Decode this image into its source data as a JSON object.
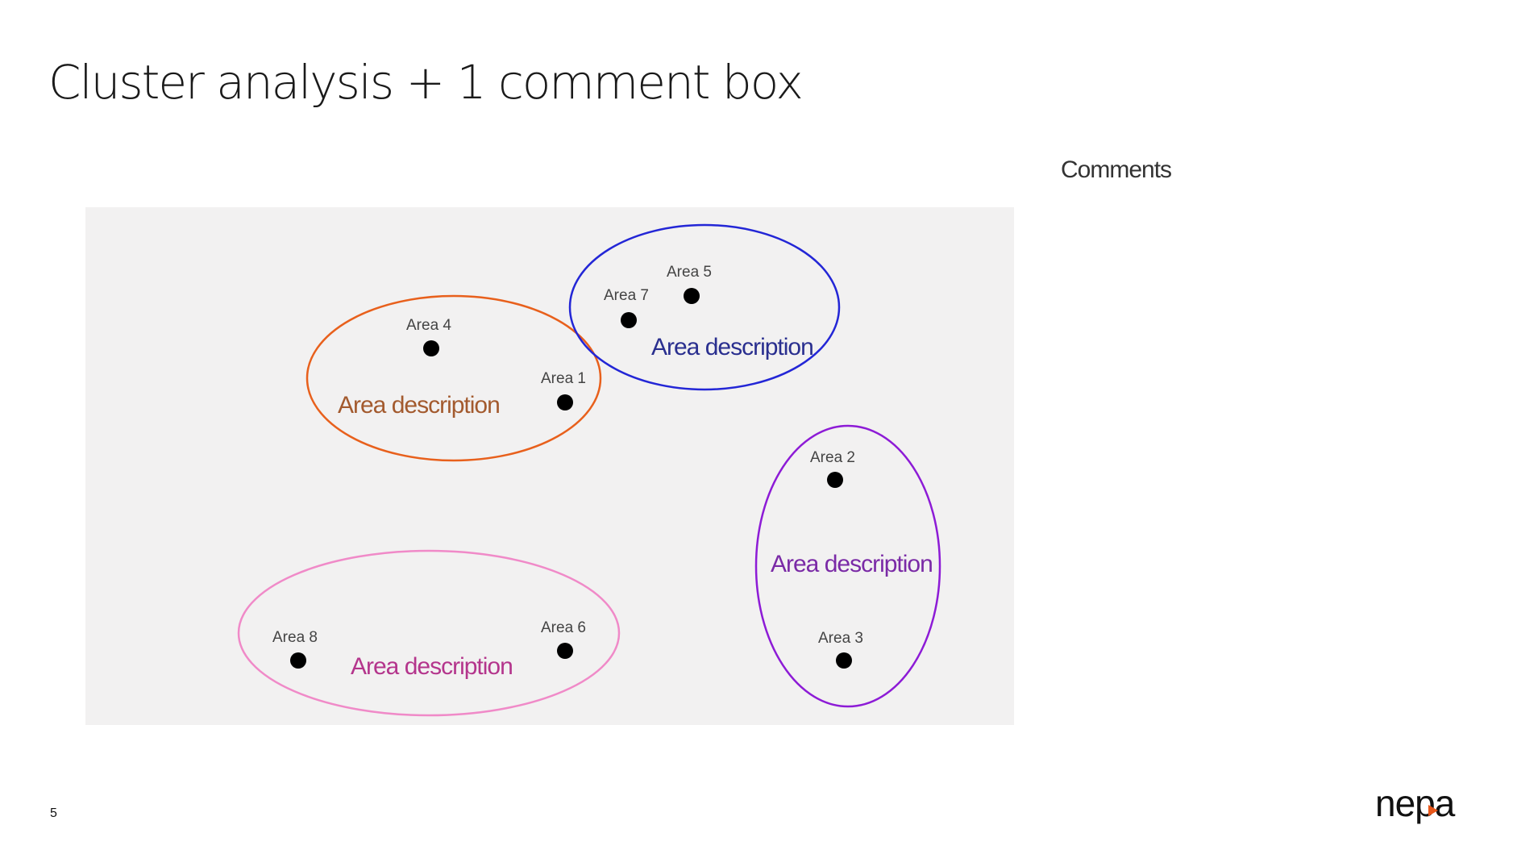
{
  "slide": {
    "title": "Cluster analysis + 1 comment box",
    "page_number": "5"
  },
  "comments": {
    "heading": "Comments"
  },
  "logo": {
    "text": "nepa",
    "accent_color": "#e8571a"
  },
  "diagram": {
    "background": "#f2f1f1",
    "clusters": [
      {
        "id": "orange",
        "label": "Area description",
        "stroke": "#e8601c",
        "text_color": "#a35a2e"
      },
      {
        "id": "blue",
        "label": "Area description",
        "stroke": "#2326d6",
        "text_color": "#2a2f8f"
      },
      {
        "id": "purple",
        "label": "Area description",
        "stroke": "#8d1bd6",
        "text_color": "#7a2aa6"
      },
      {
        "id": "pink",
        "label": "Area description",
        "stroke": "#f08ac8",
        "text_color": "#b4358c"
      }
    ],
    "points": [
      {
        "label": "Area 1"
      },
      {
        "label": "Area 2"
      },
      {
        "label": "Area 3"
      },
      {
        "label": "Area 4"
      },
      {
        "label": "Area 5"
      },
      {
        "label": "Area 6"
      },
      {
        "label": "Area 7"
      },
      {
        "label": "Area 8"
      }
    ]
  }
}
